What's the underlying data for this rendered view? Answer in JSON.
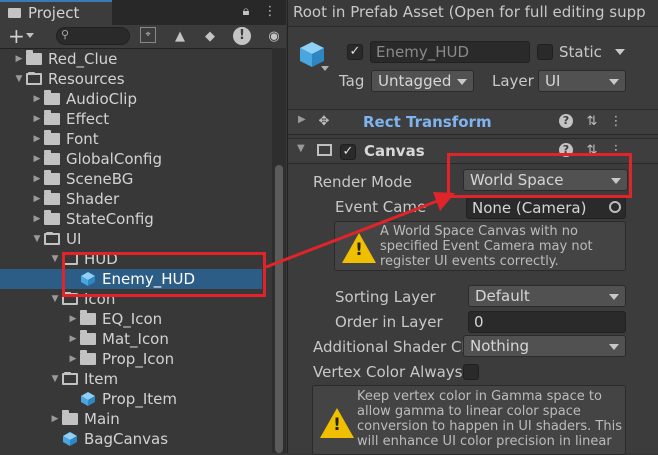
{
  "project": {
    "tab_label": "Project",
    "add_label": "+",
    "search_placeholder": "",
    "tree": [
      {
        "label": "Red_Clue",
        "kind": "folder",
        "expanded": false
      },
      {
        "label": "Resources",
        "kind": "folder",
        "expanded": true
      },
      {
        "label": "AudioClip",
        "kind": "folder",
        "expanded": false
      },
      {
        "label": "Effect",
        "kind": "folder",
        "expanded": false
      },
      {
        "label": "Font",
        "kind": "folder",
        "expanded": false
      },
      {
        "label": "GlobalConfig",
        "kind": "folder",
        "expanded": false
      },
      {
        "label": "SceneBG",
        "kind": "folder",
        "expanded": false
      },
      {
        "label": "Shader",
        "kind": "folder",
        "expanded": false
      },
      {
        "label": "StateConfig",
        "kind": "folder",
        "expanded": false
      },
      {
        "label": "UI",
        "kind": "folder",
        "expanded": true
      },
      {
        "label": "HUD",
        "kind": "folder",
        "expanded": true
      },
      {
        "label": "Enemy_HUD",
        "kind": "prefab",
        "selected": true
      },
      {
        "label": "Icon",
        "kind": "folder",
        "expanded": true
      },
      {
        "label": "EQ_Icon",
        "kind": "folder",
        "expanded": false
      },
      {
        "label": "Mat_Icon",
        "kind": "folder",
        "expanded": false
      },
      {
        "label": "Prop_Icon",
        "kind": "folder",
        "expanded": false
      },
      {
        "label": "Item",
        "kind": "folder",
        "expanded": true
      },
      {
        "label": "Prop_Item",
        "kind": "prefab"
      },
      {
        "label": "Main",
        "kind": "folder",
        "expanded": false
      },
      {
        "label": "BagCanvas",
        "kind": "prefab"
      }
    ]
  },
  "inspector": {
    "top_message": "Root in Prefab Asset (Open for full editing supp",
    "object_name": "Enemy_HUD",
    "static_label": "Static",
    "tag_label": "Tag",
    "tag_value": "Untagged",
    "layer_label": "Layer",
    "layer_value": "UI",
    "rect_transform_label": "Rect Transform",
    "canvas_label": "Canvas",
    "render_mode_label": "Render Mode",
    "render_mode_value": "World Space",
    "event_camera_label": "Event Came",
    "event_camera_value": "None (Camera)",
    "warning_text": [
      "A World Space Canvas with no",
      "specified Event Camera may not",
      "register UI events correctly."
    ],
    "sorting_layer_label": "Sorting Layer",
    "sorting_layer_value": "Default",
    "order_in_layer_label": "Order in Layer",
    "order_in_layer_value": "0",
    "additional_shader_label": "Additional Shader Ch",
    "additional_shader_value": "Nothing",
    "vertex_color_label": "Vertex Color Always",
    "vertex_help_text": [
      "Keep vertex color in Gamma space to",
      "allow gamma to linear color space",
      "conversion to happen in UI shaders. This",
      "will enhance UI color precision in linear"
    ]
  },
  "colors": {
    "annotation": "#e0242a",
    "selection": "#2c5d87",
    "link_blue": "#7fb4f0",
    "warning": "#f0c000"
  },
  "icons": [
    "folder-icon",
    "prefab-cube-icon",
    "lock-icon",
    "menu-dots-icon",
    "search-icon",
    "help-icon",
    "settings-sliders-icon",
    "warning-icon",
    "target-picker-icon"
  ]
}
